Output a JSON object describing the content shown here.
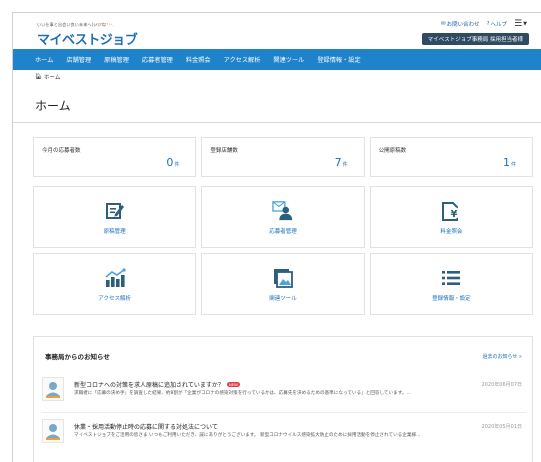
{
  "header": {
    "tagline": "いい仕事と出会い良い未来へ(いいね",
    "logo": "マイベストジョブ",
    "contact": "お問い合わせ",
    "help": "ヘルプ",
    "account": "マイベストジョブ事務局 採用担当者様"
  },
  "nav": [
    "ホーム",
    "店舗管理",
    "原稿管理",
    "応募者管理",
    "料金照会",
    "アクセス解析",
    "関連ツール",
    "登録情報・設定"
  ],
  "breadcrumb": "ホーム",
  "page_title": "ホーム",
  "stats": [
    {
      "label": "今月の応募者数",
      "value": "0",
      "unit": "件"
    },
    {
      "label": "登録店舗数",
      "value": "7",
      "unit": "件"
    },
    {
      "label": "公開原稿数",
      "value": "1",
      "unit": "件"
    }
  ],
  "tiles": [
    {
      "label": "原稿管理",
      "icon": "edit-icon"
    },
    {
      "label": "応募者管理",
      "icon": "applicant-icon"
    },
    {
      "label": "料金照会",
      "icon": "yen-document-icon"
    },
    {
      "label": "アクセス解析",
      "icon": "analytics-icon"
    },
    {
      "label": "関連ツール",
      "icon": "image-tool-icon"
    },
    {
      "label": "登録情報・設定",
      "icon": "list-icon"
    }
  ],
  "notices": {
    "heading": "事務局からのお知らせ",
    "past_link": "過去のお知らせ »",
    "items": [
      {
        "title": "新型コロナへの対策を求人原稿に追加されていますか？",
        "badge": "NEW",
        "date": "2020年06月07日",
        "body": "求職者に「応募の決め手」を調査した結果、約8割が「企業がコロナの感染対策を行っているかは、応募先を決めるための基準になっている」と回答しています。…"
      },
      {
        "title": "休業・採用活動停止時の応募に関する対処法について",
        "badge": "",
        "date": "2020年05月01日",
        "body": "マイベストジョブをご活用の皆さま いつもご利用いただき、誠にありがとうございます。 新型コロナウイルス感染拡大防止のために採用活動を停止されている企業様…"
      }
    ]
  },
  "colors": {
    "nav": "#1f83cc",
    "accent": "#1c6fb8",
    "account": "#2e4b63",
    "badge": "#e23d4a"
  }
}
